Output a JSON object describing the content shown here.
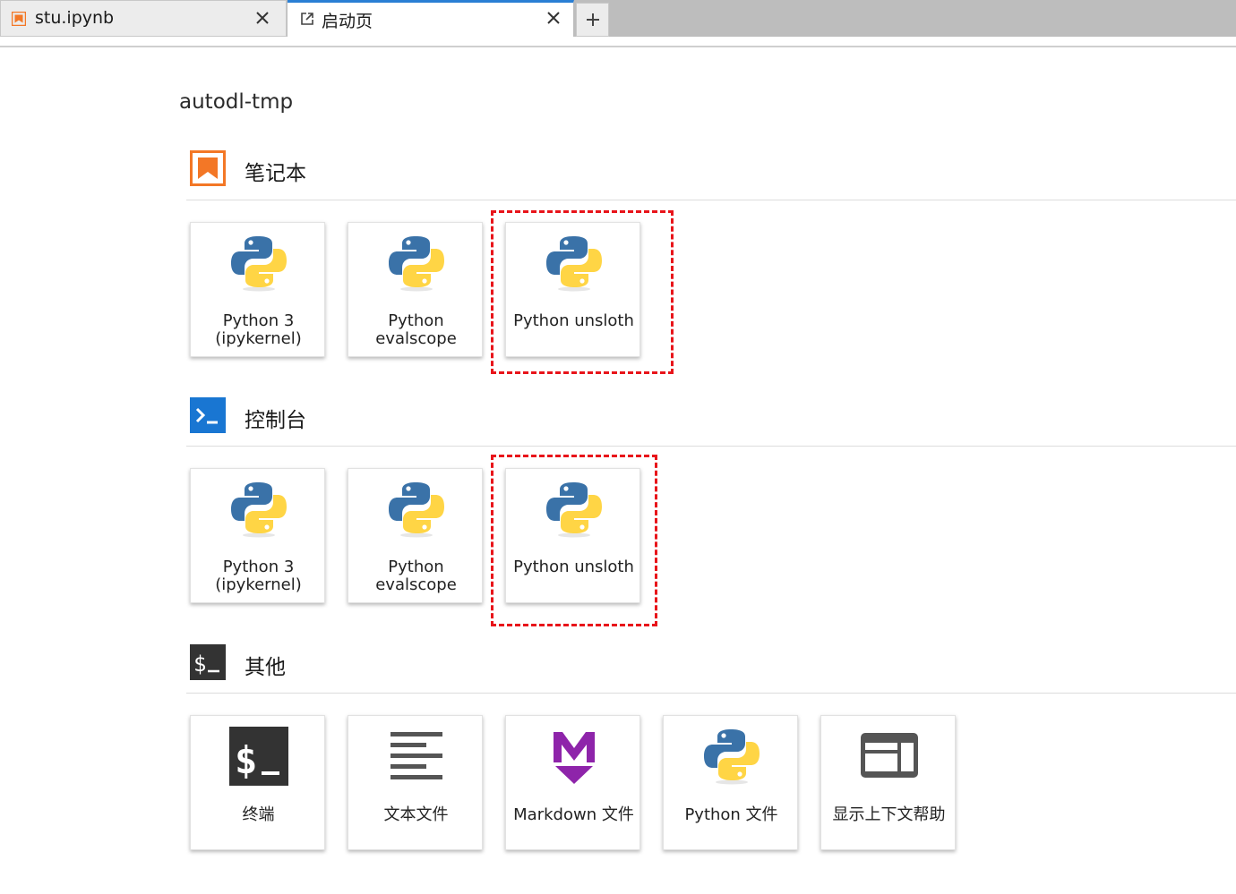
{
  "tabs": [
    {
      "label": "stu.ipynb",
      "icon": "notebook-icon",
      "active": false
    },
    {
      "label": "启动页",
      "icon": "launcher-icon",
      "active": true
    }
  ],
  "directory": "autodl-tmp",
  "sections": {
    "notebook": {
      "title": "笔记本",
      "icon": "notebook-section-icon",
      "color": "#f37726",
      "cards": [
        {
          "label": "Python 3\n(ipykernel)"
        },
        {
          "label": "Python\nevalscope"
        },
        {
          "label": "Python unsloth"
        }
      ]
    },
    "console": {
      "title": "控制台",
      "icon": "console-section-icon",
      "color": "#1976d2",
      "cards": [
        {
          "label": "Python 3\n(ipykernel)"
        },
        {
          "label": "Python\nevalscope"
        },
        {
          "label": "Python unsloth"
        }
      ]
    },
    "other": {
      "title": "其他",
      "icon": "terminal-section-icon",
      "color": "#333333",
      "cards": [
        {
          "label": "终端",
          "icon": "terminal-icon"
        },
        {
          "label": "文本文件",
          "icon": "text-file-icon"
        },
        {
          "label": "Markdown 文件",
          "icon": "markdown-icon"
        },
        {
          "label": "Python 文件",
          "icon": "python-file-icon"
        },
        {
          "label": "显示上下文帮助",
          "icon": "context-help-icon"
        }
      ]
    }
  },
  "colors": {
    "accent": "#2a7fd4",
    "highlight": "#e8141a",
    "python_blue": "#3a72a8",
    "python_yellow": "#ffd545",
    "markdown_purple": "#8e24aa"
  }
}
